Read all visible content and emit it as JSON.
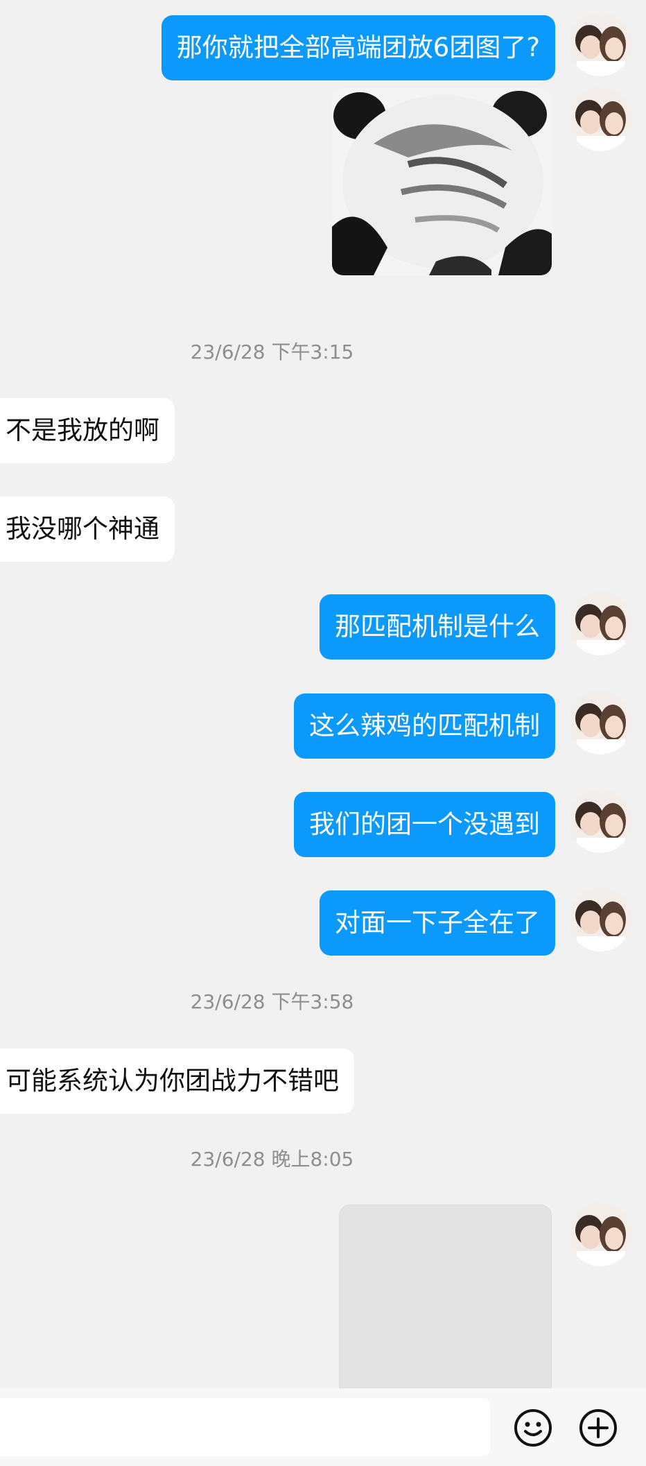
{
  "messages": [
    {
      "type": "outgoing",
      "text": "那你就把全部高端团放6团图了?"
    },
    {
      "type": "outgoing_sticker",
      "sticker": "panda-meme-face"
    },
    {
      "type": "timestamp",
      "text": "23/6/28 下午3:15"
    },
    {
      "type": "incoming",
      "text": "不是我放的啊"
    },
    {
      "type": "incoming",
      "text": "我没哪个神通"
    },
    {
      "type": "outgoing",
      "text": "那匹配机制是什么"
    },
    {
      "type": "outgoing",
      "text": "这么辣鸡的匹配机制"
    },
    {
      "type": "outgoing",
      "text": "我们的团一个没遇到"
    },
    {
      "type": "outgoing",
      "text": "对面一下子全在了"
    },
    {
      "type": "timestamp",
      "text": "23/6/28 下午3:58"
    },
    {
      "type": "incoming",
      "text": "可能系统认为你团战力不错吧"
    },
    {
      "type": "timestamp",
      "text": "23/6/28 晚上8:05"
    },
    {
      "type": "outgoing_image",
      "state": "loading"
    }
  ],
  "input_bar": {
    "placeholder": "",
    "emoji_icon": "smiley-icon",
    "more_icon": "plus-circle-icon"
  },
  "colors": {
    "outgoing_bubble": "#0b99fb",
    "incoming_bubble": "#ffffff",
    "background": "#f1f1f1",
    "timestamp_text": "#8e8e8e"
  }
}
